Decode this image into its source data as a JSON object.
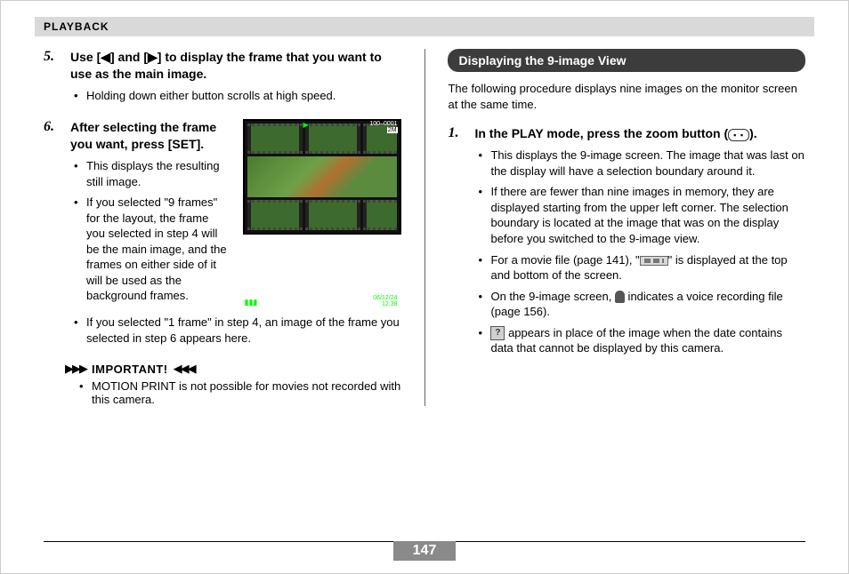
{
  "header": {
    "section_label": "PLAYBACK"
  },
  "left": {
    "step5": {
      "num": "5.",
      "title": "Use [◀] and [▶] to display the frame that you want to use as the main image.",
      "bullets": [
        "Holding down either button scrolls at high speed."
      ]
    },
    "step6": {
      "num": "6.",
      "title": "After selecting the frame you want, press [SET].",
      "bullets_a": [
        "This displays the resulting still image.",
        "If you selected \"9 frames\" for the layout, the frame you selected in step 4 will be the main image, and the frames on either side of it will be used as the background frames."
      ],
      "bullets_b": [
        "If you selected \"1 frame\" in step 4, an image of the frame you selected in step 6 appears here."
      ]
    },
    "lcd": {
      "filecounter": "100–0001",
      "size_badge": "2M",
      "date": "06/12/24",
      "time": "12:38"
    },
    "important": {
      "label": "IMPORTANT!",
      "body": "MOTION PRINT is not possible for movies not recorded with this camera."
    }
  },
  "right": {
    "heading": "Displaying the 9-image View",
    "intro": "The following procedure displays nine images on the monitor screen at the same time.",
    "step1": {
      "num": "1.",
      "title_before_icon": "In the PLAY mode, press the zoom button (",
      "title_after_icon": ").",
      "b1": "This displays the 9-image screen. The image that was last on the display will have a selection boundary around it.",
      "b2": "If there are fewer than nine images in memory, they are displayed starting from the upper left corner. The selection boundary is located at the image that was on the display before you switched to the 9-image view.",
      "b3_before": "For a movie file (page 141), \"",
      "b3_after": "\" is displayed at the top and bottom of the screen.",
      "b4_before": "On the 9-image screen, ",
      "b4_after": " indicates a voice recording file (page 156).",
      "b5_before": "",
      "b5_after": " appears in place of the image when the date contains data that cannot be displayed by this camera."
    }
  },
  "footer": {
    "page": "147"
  }
}
